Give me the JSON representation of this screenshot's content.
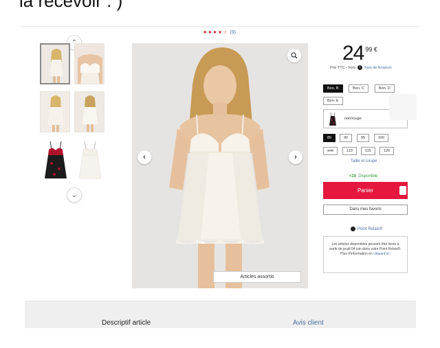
{
  "caption": {
    "text": "la recevoir : )"
  },
  "rating": {
    "stars": "★★★★☆",
    "count": "(9)"
  },
  "thumbnails": [
    {
      "name": "thumb-1",
      "active": true
    },
    {
      "name": "thumb-2",
      "active": false
    },
    {
      "name": "thumb-3",
      "active": false
    },
    {
      "name": "thumb-4",
      "active": false
    },
    {
      "name": "thumb-5",
      "active": false
    },
    {
      "name": "thumb-6",
      "active": false
    }
  ],
  "main_image": {
    "assortis_label": "Articles assortis"
  },
  "price": {
    "integer": "24",
    "cents": "99 €",
    "note": "Prix TTC - hors",
    "shipping_link": "frais de livraison"
  },
  "cup_sizes": [
    {
      "label": "Bon. B",
      "selected": true
    },
    {
      "label": "Bon. C",
      "selected": false
    },
    {
      "label": "Bon. D",
      "selected": false
    },
    {
      "label": "Bon. E",
      "selected": false
    }
  ],
  "color": {
    "label": "noir/rouge",
    "swatch": "#2a1a1e"
  },
  "sizes": [
    {
      "label": "85",
      "selected": true,
      "unavailable": false
    },
    {
      "label": "90",
      "selected": false,
      "unavailable": false
    },
    {
      "label": "95",
      "selected": false,
      "unavailable": false
    },
    {
      "label": "100",
      "selected": false,
      "unavailable": false
    },
    {
      "label": "105",
      "selected": false,
      "unavailable": true
    },
    {
      "label": "110",
      "selected": false,
      "unavailable": false
    },
    {
      "label": "115",
      "selected": false,
      "unavailable": false
    },
    {
      "label": "120",
      "selected": false,
      "unavailable": false
    }
  ],
  "size_guide": "Taille et coupe",
  "availability": {
    "icon": "<10",
    "label": "Disponible"
  },
  "cart_button": "Panier",
  "favorites_button": "Dans mes favoris",
  "relais": {
    "label": "Point Relais®",
    "info": "Les articles disponibles peuvent être livrés à partir de jeudi 04 juin dans votre Point Relais®. Plus d'information en",
    "link": "cliquant ici."
  },
  "tabs": {
    "description": "Descriptif article",
    "reviews": "Avis client"
  },
  "colors": {
    "accent": "#e5173e",
    "link": "#4a6fa5",
    "available": "#3a9a3a"
  }
}
